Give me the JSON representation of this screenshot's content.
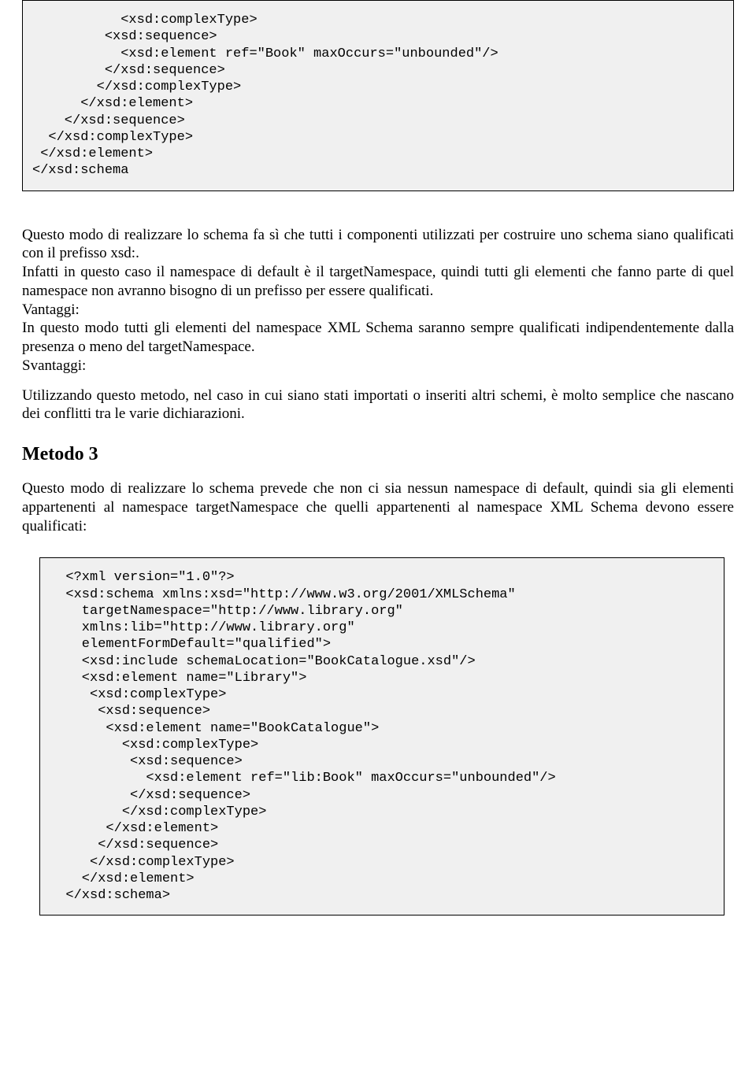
{
  "codebox1": "           <xsd:complexType>\n         <xsd:sequence>\n           <xsd:element ref=\"Book\" maxOccurs=\"unbounded\"/>\n         </xsd:sequence>\n        </xsd:complexType>\n      </xsd:element>\n    </xsd:sequence>\n  </xsd:complexType>\n </xsd:element>\n</xsd:schema",
  "para1": "Questo modo di realizzare lo schema fa sì che tutti i componenti utilizzati per costruire uno schema siano qualificati con il prefisso xsd:.",
  "para2": "Infatti in questo caso il namespace di default è il targetNamespace, quindi tutti gli elementi che fanno parte di quel namespace non avranno bisogno di un prefisso per essere qualificati.",
  "para3_label": "Vantaggi:",
  "para3": "In questo modo tutti gli elementi del namespace XML Schema saranno sempre qualificati indipendentemente dalla presenza o meno del targetNamespace.",
  "para4_label": "Svantaggi:",
  "para5": "Utilizzando questo metodo, nel caso in cui siano stati importati o inseriti altri schemi, è molto semplice che nascano dei conflitti tra le varie dichiarazioni.",
  "heading": "Metodo 3",
  "para6": "Questo modo di realizzare lo schema prevede che non ci sia nessun namespace di default, quindi sia gli elementi appartenenti al namespace targetNamespace che quelli appartenenti al namespace XML Schema devono essere qualificati:",
  "codebox2": "  <?xml version=\"1.0\"?>\n  <xsd:schema xmlns:xsd=\"http://www.w3.org/2001/XMLSchema\"\n    targetNamespace=\"http://www.library.org\"\n    xmlns:lib=\"http://www.library.org\"\n    elementFormDefault=\"qualified\">\n    <xsd:include schemaLocation=\"BookCatalogue.xsd\"/>\n    <xsd:element name=\"Library\">\n     <xsd:complexType>\n      <xsd:sequence>\n       <xsd:element name=\"BookCatalogue\">\n         <xsd:complexType>\n          <xsd:sequence>\n            <xsd:element ref=\"lib:Book\" maxOccurs=\"unbounded\"/>\n          </xsd:sequence>\n         </xsd:complexType>\n       </xsd:element>\n      </xsd:sequence>\n     </xsd:complexType>\n    </xsd:element>\n  </xsd:schema>"
}
